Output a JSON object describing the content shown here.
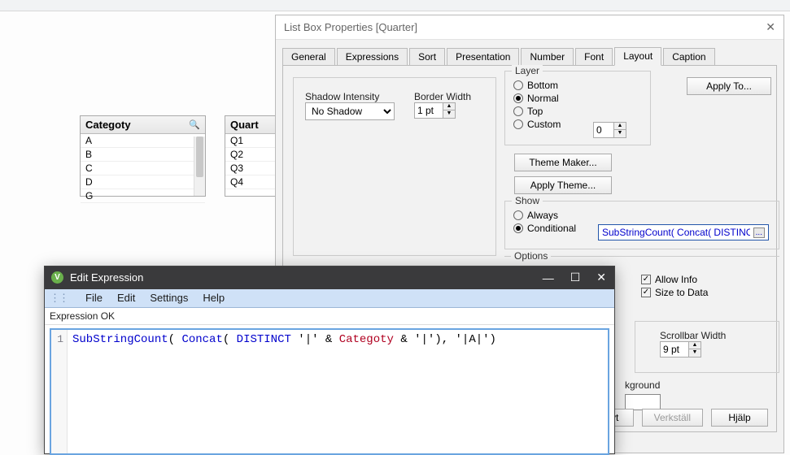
{
  "listboxes": {
    "categoty": {
      "title": "Categoty",
      "items": [
        "A",
        "B",
        "C",
        "D",
        "G"
      ]
    },
    "quarter": {
      "title": "Quart",
      "items": [
        "Q1",
        "Q2",
        "Q3",
        "Q4"
      ]
    }
  },
  "dialog": {
    "title": "List Box Properties [Quarter]",
    "tabs": [
      "General",
      "Expressions",
      "Sort",
      "Presentation",
      "Number",
      "Font",
      "Layout",
      "Caption"
    ],
    "buttons": [
      "ryt",
      "Verkställ",
      "Hjälp"
    ]
  },
  "layout": {
    "shadow_label": "Shadow Intensity",
    "shadow_value": "No Shadow",
    "border_label": "Border Width",
    "border_value": "1 pt",
    "apply_to": "Apply To...",
    "theme_maker": "Theme Maker...",
    "apply_theme": "Apply Theme...",
    "layer": {
      "title": "Layer",
      "options": [
        "Bottom",
        "Normal",
        "Top",
        "Custom"
      ],
      "selected": "Normal",
      "custom_value": "0"
    },
    "show": {
      "title": "Show",
      "options": [
        "Always",
        "Conditional"
      ],
      "selected": "Conditional",
      "condition": "SubStringCount( Concat( DISTINC"
    },
    "options": {
      "title": "Options"
    },
    "right": {
      "allow_info": "Allow Info",
      "size_to_data": "Size to Data"
    },
    "scrollbars": {
      "label": "Scrollbar Width",
      "value": "9 pt"
    },
    "background_label": "kground"
  },
  "expr": {
    "title": "Edit Expression",
    "menus": [
      "File",
      "Edit",
      "Settings",
      "Help"
    ],
    "status": "Expression OK",
    "tokens": [
      "SubStringCount",
      "( ",
      "Concat",
      "( ",
      "DISTINCT",
      " '|' & ",
      "Categoty",
      " & '|'), '|A|')"
    ],
    "full_expression": "SubStringCount( Concat( DISTINCT '|' & Categoty & '|'), '|A|')"
  }
}
